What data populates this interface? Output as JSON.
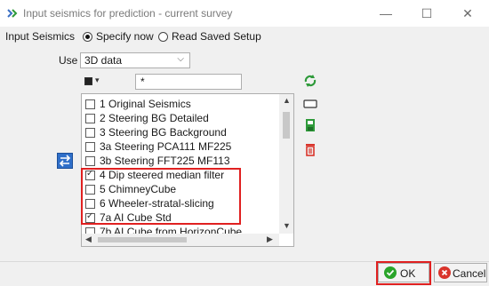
{
  "window": {
    "title": "Input seismics for prediction - current survey",
    "minimize_glyph": "—",
    "maximize_glyph": "☐",
    "close_glyph": "✕"
  },
  "input_seismics": {
    "label": "Input Seismics",
    "option_specify": "Specify now",
    "option_read": "Read Saved Setup",
    "selected": "Specify now"
  },
  "use": {
    "label": "Use",
    "value": "3D data"
  },
  "filter": {
    "value": "*"
  },
  "list": {
    "items": [
      {
        "label": "1 Original Seismics",
        "checked": false
      },
      {
        "label": "2 Steering BG Detailed",
        "checked": false
      },
      {
        "label": "3 Steering BG Background",
        "checked": false
      },
      {
        "label": "3a Steering PCA111 MF225",
        "checked": false
      },
      {
        "label": "3b Steering FFT225 MF113",
        "checked": false
      },
      {
        "label": "4 Dip steered median filter",
        "checked": true
      },
      {
        "label": "5 ChimneyCube",
        "checked": false
      },
      {
        "label": "6 Wheeler-stratal-slicing",
        "checked": false
      },
      {
        "label": "7a AI Cube Std",
        "checked": true
      },
      {
        "label": "7b AI Cube from HorizonCube",
        "checked": false
      }
    ]
  },
  "icons": {
    "refresh": "refresh-icon",
    "rectangle": "rectangle-icon",
    "save": "save-icon",
    "delete": "delete-icon",
    "switch": "switch-icon"
  },
  "footer": {
    "ok_label": "OK",
    "cancel_label": "Cancel"
  },
  "colors": {
    "highlight_red": "#e02020",
    "ok_green": "#2aa52a",
    "cancel_red": "#d9342b"
  }
}
